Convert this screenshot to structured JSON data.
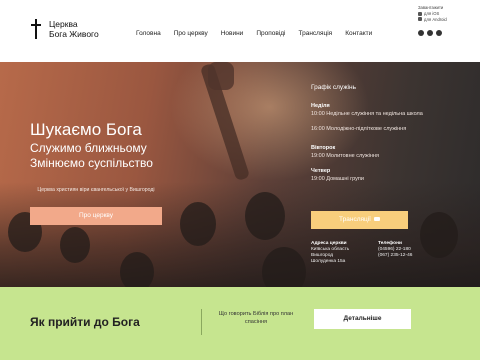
{
  "header": {
    "logo_line1": "Церква",
    "logo_line2": "Бога Живого",
    "nav": [
      "Головна",
      "Про церкву",
      "Новини",
      "Проповіді",
      "Трансляція",
      "Контакти"
    ],
    "apps_title": "Завантажити",
    "app_ios": "для iOS",
    "app_android": "для Android"
  },
  "hero": {
    "title": "Шукаємо Бога",
    "subtitle1": "Служимо ближньому",
    "subtitle2": "Змінюємо суспільство",
    "description": "Церква християн віри євангельської у Вишгороді",
    "about_button": "Про церкву",
    "schedule": {
      "title": "Графік служінь",
      "days": [
        {
          "day": "Неділя",
          "events": [
            "10:00 Недільне служіння та недільна школа",
            "16:00 Молодіжно-підліткове служіння"
          ]
        },
        {
          "day": "Вівторок",
          "events": [
            "19:00 Молитовне служіння"
          ]
        },
        {
          "day": "Четвер",
          "events": [
            "19:00 Домашні групи"
          ]
        }
      ]
    },
    "live_button": "Трансляції",
    "address": {
      "label": "Адреса церкви",
      "lines": [
        "Київська область",
        "Вишгород",
        "Шолуденка 15а"
      ]
    },
    "phones": {
      "label": "Телефони",
      "lines": [
        "(04596) 22-180",
        "(067) 235-12-46"
      ]
    }
  },
  "band": {
    "title": "Як прийти до Бога",
    "text": "Що говорить Біблія про план спасіння",
    "button": "Детальніше"
  },
  "colors": {
    "accent_salmon": "#f2a98a",
    "accent_yellow": "#f8ce7c",
    "band_green": "#c6e58f"
  }
}
